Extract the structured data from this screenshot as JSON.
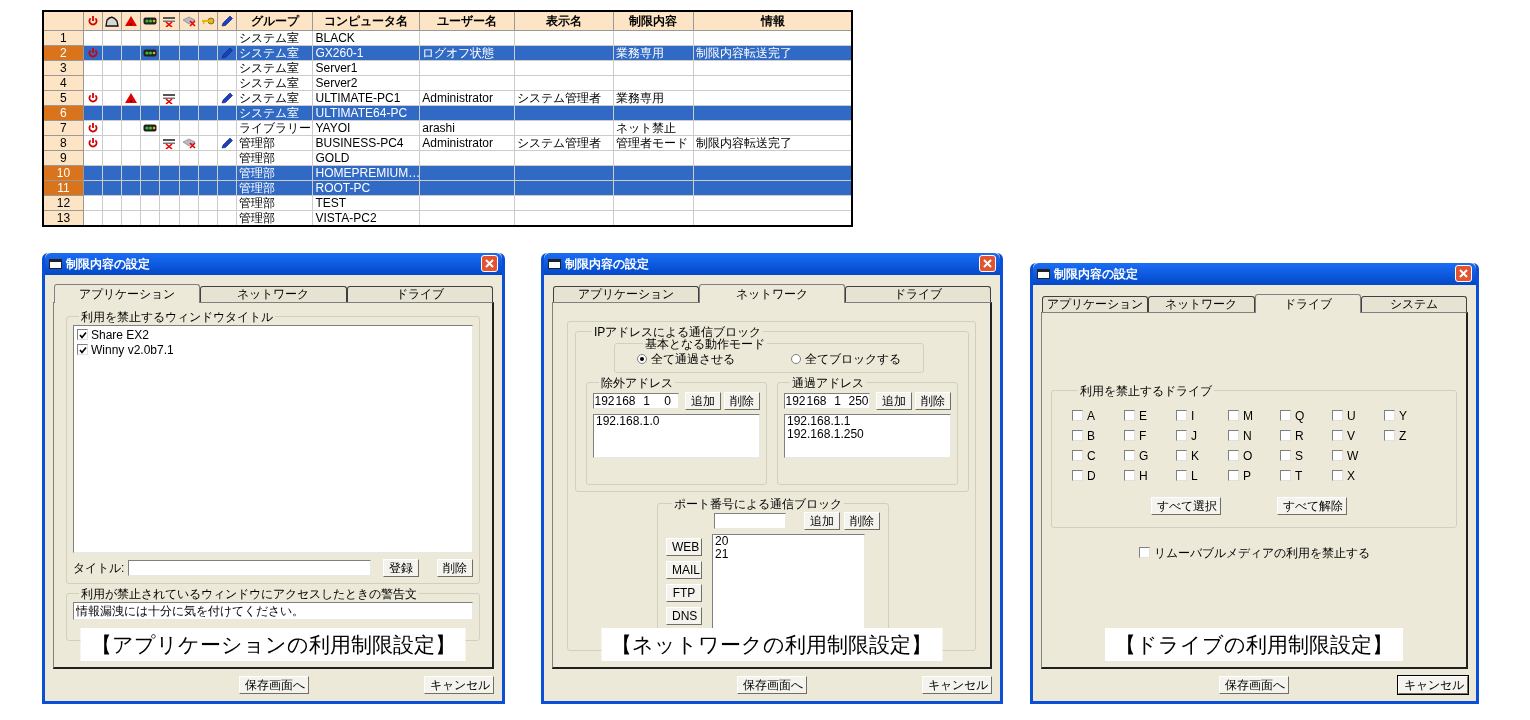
{
  "table": {
    "icon_columns": [
      {
        "kind": "power"
      },
      {
        "kind": "dome"
      },
      {
        "kind": "warning"
      },
      {
        "kind": "signal"
      },
      {
        "kind": "network"
      },
      {
        "kind": "printer"
      },
      {
        "kind": "key"
      },
      {
        "kind": "pen"
      }
    ],
    "columns": [
      "グループ",
      "コンピュータ名",
      "ユーザー名",
      "表示名",
      "制限内容",
      "情報"
    ],
    "rows": [
      {
        "number": "1",
        "selected": false,
        "power": false,
        "dome": false,
        "warning": false,
        "signal": false,
        "network": false,
        "printer": false,
        "key": false,
        "pen": false,
        "group": "システム室",
        "computer": "BLACK"
      },
      {
        "number": "2",
        "selected": true,
        "power": true,
        "dome": false,
        "warning": false,
        "signal": true,
        "network": false,
        "printer": false,
        "key": false,
        "pen": true,
        "group": "システム室",
        "computer": "GX260-1",
        "user": "ログオフ状態",
        "restriction": "業務専用",
        "info": "制限内容転送完了"
      },
      {
        "number": "3",
        "selected": false,
        "power": false,
        "dome": false,
        "warning": false,
        "signal": false,
        "network": false,
        "printer": false,
        "key": false,
        "pen": false,
        "group": "システム室",
        "computer": "Server1"
      },
      {
        "number": "4",
        "selected": false,
        "power": false,
        "dome": false,
        "warning": false,
        "signal": false,
        "network": false,
        "printer": false,
        "key": false,
        "pen": false,
        "group": "システム室",
        "computer": "Server2"
      },
      {
        "number": "5",
        "selected": false,
        "power": true,
        "dome": false,
        "warning": true,
        "signal": false,
        "network": true,
        "printer": false,
        "key": false,
        "pen": true,
        "group": "システム室",
        "computer": "ULTIMATE-PC1",
        "user": "Administrator",
        "display_name": "システム管理者",
        "restriction": "業務専用"
      },
      {
        "number": "6",
        "selected": true,
        "power": false,
        "dome": false,
        "warning": false,
        "signal": false,
        "network": false,
        "printer": false,
        "key": false,
        "pen": false,
        "group": "システム室",
        "computer": "ULTIMATE64-PC"
      },
      {
        "number": "7",
        "selected": false,
        "power": true,
        "dome": false,
        "warning": false,
        "signal": true,
        "network": false,
        "printer": false,
        "key": false,
        "pen": false,
        "group": "ライブラリー",
        "computer": "YAYOI",
        "user": "arashi",
        "restriction": "ネット禁止"
      },
      {
        "number": "8",
        "selected": false,
        "power": true,
        "dome": false,
        "warning": false,
        "signal": false,
        "network": true,
        "printer": true,
        "key": false,
        "pen": true,
        "group": "管理部",
        "computer": "BUSINESS-PC4",
        "user": "Administrator",
        "display_name": "システム管理者",
        "restriction": "管理者モード",
        "info": "制限内容転送完了"
      },
      {
        "number": "9",
        "selected": false,
        "power": false,
        "dome": false,
        "warning": false,
        "signal": false,
        "network": false,
        "printer": false,
        "key": false,
        "pen": false,
        "group": "管理部",
        "computer": "GOLD"
      },
      {
        "number": "10",
        "selected": true,
        "power": false,
        "dome": false,
        "warning": false,
        "signal": false,
        "network": false,
        "printer": false,
        "key": false,
        "pen": false,
        "group": "管理部",
        "computer": "HOMEPREMIUM…"
      },
      {
        "number": "11",
        "selected": true,
        "power": false,
        "dome": false,
        "warning": false,
        "signal": false,
        "network": false,
        "printer": false,
        "key": false,
        "pen": false,
        "group": "管理部",
        "computer": "ROOT-PC"
      },
      {
        "number": "12",
        "selected": false,
        "power": false,
        "dome": false,
        "warning": false,
        "signal": false,
        "network": false,
        "printer": false,
        "key": false,
        "pen": false,
        "group": "管理部",
        "computer": "TEST"
      },
      {
        "number": "13",
        "selected": false,
        "power": false,
        "dome": false,
        "warning": false,
        "signal": false,
        "network": false,
        "printer": false,
        "key": false,
        "pen": false,
        "group": "管理部",
        "computer": "VISTA-PC2"
      }
    ]
  },
  "dialogs": [
    {
      "title": "制限内容の設定",
      "tabs": [
        {
          "label": "アプリケーション",
          "selected": true
        },
        {
          "label": "ネットワーク",
          "selected": false
        },
        {
          "label": "ドライブ",
          "selected": false
        }
      ],
      "content": {
        "kind": "application",
        "window_titles": {
          "label": "利用を禁止するウィンドウタイトル",
          "items": [
            {
              "label": "Share EX2",
              "checked": true
            },
            {
              "label": "Winny v2.0b7.1",
              "checked": true
            }
          ],
          "title_label": "タイトル:",
          "buttons": [
            "登録",
            "削除"
          ]
        },
        "warning": {
          "label": "利用が禁止されているウィンドウにアクセスしたときの警告文",
          "value": "情報漏洩には十分に気を付けてください。"
        }
      },
      "caption": "【アプリケーションの利用制限設定】",
      "buttons": [
        {
          "label": "保存画面へ",
          "focused": false
        },
        {
          "label": "キャンセル",
          "focused": false
        }
      ]
    },
    {
      "title": "制限内容の設定",
      "tabs": [
        {
          "label": "アプリケーション",
          "selected": false
        },
        {
          "label": "ネットワーク",
          "selected": true
        },
        {
          "label": "ドライブ",
          "selected": false
        }
      ],
      "content": {
        "kind": "network",
        "ip_block": {
          "label": "IPアドレスによる通信ブロック",
          "mode": {
            "label": "基本となる動作モード",
            "options": [
              {
                "label": "全て通過させる",
                "selected": true
              },
              {
                "label": "全てブロックする",
                "selected": false
              }
            ]
          },
          "lists": [
            {
              "label": "除外アドレス",
              "octets": [
                "192",
                "168",
                "1",
                "0"
              ],
              "buttons": [
                "追加",
                "削除"
              ],
              "items": [
                "192.168.1.0"
              ]
            },
            {
              "label": "通過アドレス",
              "octets": [
                "192",
                "168",
                "1",
                "250"
              ],
              "buttons": [
                "追加",
                "削除"
              ],
              "items": [
                "192.168.1.1",
                "192.168.1.250"
              ]
            }
          ]
        },
        "port_block": {
          "label": "ポート番号による通信ブロック",
          "buttons": [
            "追加",
            "削除"
          ],
          "presets": [
            "WEB",
            "MAIL",
            "FTP",
            "DNS"
          ],
          "items": [
            "20",
            "21"
          ]
        }
      },
      "caption": "【ネットワークの利用制限設定】",
      "buttons": [
        {
          "label": "保存画面へ",
          "focused": false
        },
        {
          "label": "キャンセル",
          "focused": false
        }
      ]
    },
    {
      "title": "制限内容の設定",
      "tabs": [
        {
          "label": "アプリケーション",
          "selected": false
        },
        {
          "label": "ネットワーク",
          "selected": false
        },
        {
          "label": "ドライブ",
          "selected": true
        },
        {
          "label": "システム",
          "selected": false
        }
      ],
      "content": {
        "kind": "drive",
        "drives": {
          "label": "利用を禁止するドライブ",
          "items": [
            {
              "label": "A",
              "checked": false
            },
            {
              "label": "B",
              "checked": false
            },
            {
              "label": "C",
              "checked": false
            },
            {
              "label": "D",
              "checked": false
            },
            {
              "label": "E",
              "checked": false
            },
            {
              "label": "F",
              "checked": false
            },
            {
              "label": "G",
              "checked": false
            },
            {
              "label": "H",
              "checked": false
            },
            {
              "label": "I",
              "checked": false
            },
            {
              "label": "J",
              "checked": false
            },
            {
              "label": "K",
              "checked": false
            },
            {
              "label": "L",
              "checked": false
            },
            {
              "label": "M",
              "checked": false
            },
            {
              "label": "N",
              "checked": false
            },
            {
              "label": "O",
              "checked": false
            },
            {
              "label": "P",
              "checked": false
            },
            {
              "label": "Q",
              "checked": false
            },
            {
              "label": "R",
              "checked": false
            },
            {
              "label": "S",
              "checked": false
            },
            {
              "label": "T",
              "checked": false
            },
            {
              "label": "U",
              "checked": false
            },
            {
              "label": "V",
              "checked": false
            },
            {
              "label": "W",
              "checked": false
            },
            {
              "label": "X",
              "checked": false
            },
            {
              "label": "Y",
              "checked": false
            },
            {
              "label": "Z",
              "checked": false
            }
          ],
          "buttons": [
            "すべて選択",
            "すべて解除"
          ]
        },
        "removable": {
          "label": "リムーバブルメディアの利用を禁止する",
          "checked": false
        }
      },
      "caption": "【ドライブの利用制限設定】",
      "buttons": [
        {
          "label": "保存画面へ",
          "focused": false
        },
        {
          "label": "キャンセル",
          "focused": true
        }
      ]
    }
  ]
}
